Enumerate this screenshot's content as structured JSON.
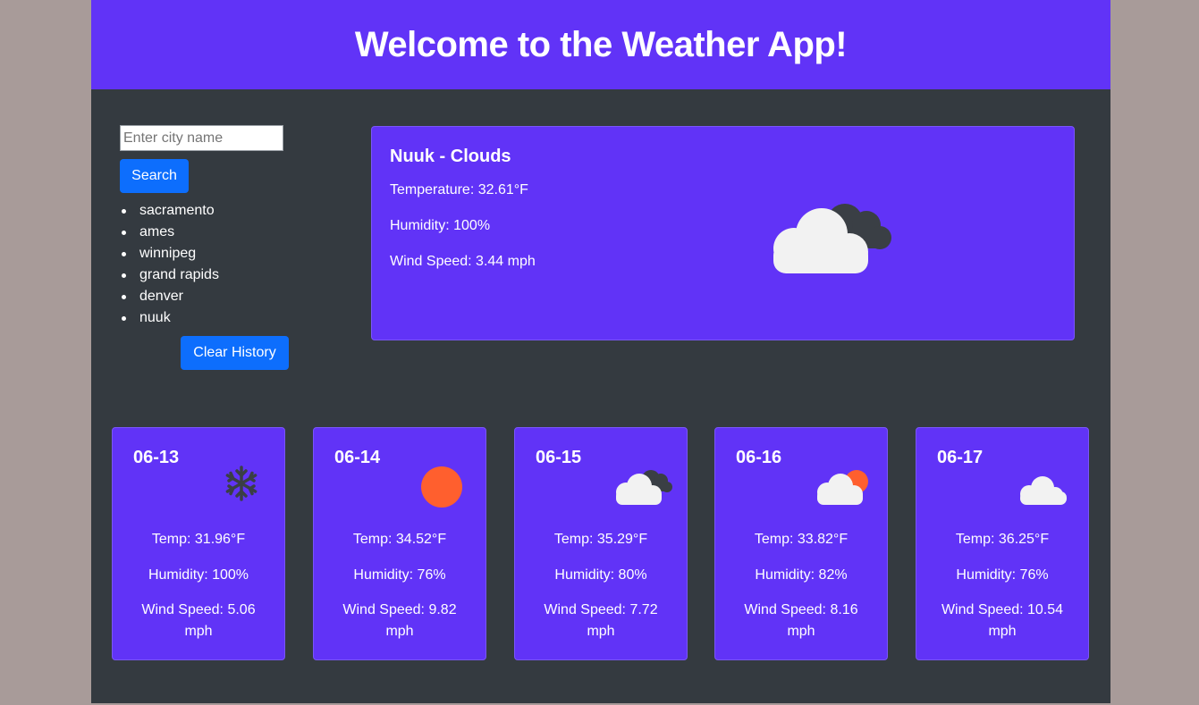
{
  "header": {
    "title": "Welcome to the Weather App!"
  },
  "search": {
    "placeholder": "Enter city name",
    "button_label": "Search"
  },
  "history": {
    "items": [
      "sacramento",
      "ames",
      "winnipeg",
      "grand rapids",
      "denver",
      "nuuk"
    ],
    "clear_label": "Clear History"
  },
  "current": {
    "heading": "Nuuk - Clouds",
    "temperature": "Temperature: 32.61°F",
    "humidity": "Humidity: 100%",
    "wind": "Wind Speed: 3.44 mph",
    "icon": "broken-clouds-icon"
  },
  "forecast": [
    {
      "date": "06-13",
      "icon": "snowflake-icon",
      "temp": "Temp: 31.96°F",
      "humidity": "Humidity: 100%",
      "wind": "Wind Speed: 5.06 mph"
    },
    {
      "date": "06-14",
      "icon": "sun-icon",
      "temp": "Temp: 34.52°F",
      "humidity": "Humidity: 76%",
      "wind": "Wind Speed: 9.82 mph"
    },
    {
      "date": "06-15",
      "icon": "broken-clouds-icon",
      "temp": "Temp: 35.29°F",
      "humidity": "Humidity: 80%",
      "wind": "Wind Speed: 7.72 mph"
    },
    {
      "date": "06-16",
      "icon": "partly-cloudy-icon",
      "temp": "Temp: 33.82°F",
      "humidity": "Humidity: 82%",
      "wind": "Wind Speed: 8.16 mph"
    },
    {
      "date": "06-17",
      "icon": "cloud-icon",
      "temp": "Temp: 36.25°F",
      "humidity": "Humidity: 76%",
      "wind": "Wind Speed: 10.54 mph"
    }
  ],
  "colors": {
    "page_bg": "#a89b99",
    "app_bg": "#343a40",
    "card_bg": "#6133f7",
    "button": "#0d6efd",
    "sun": "#ff5f2e"
  }
}
